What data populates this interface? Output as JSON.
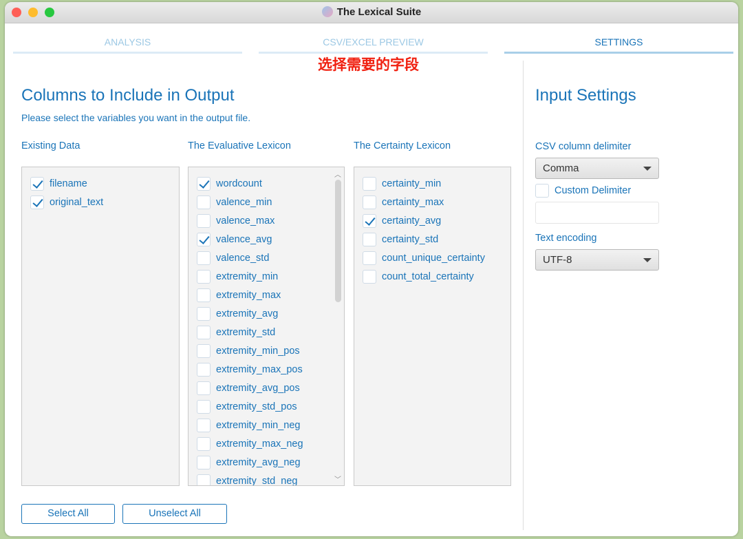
{
  "window": {
    "title": "The Lexical Suite"
  },
  "tabs": [
    {
      "label": "ANALYSIS"
    },
    {
      "label": "CSV/EXCEL PREVIEW"
    },
    {
      "label": "SETTINGS",
      "active": true
    }
  ],
  "annotation": "选择需要的字段",
  "output": {
    "title": "Columns to Include in Output",
    "subtitle": "Please select the variables you want in the output file.",
    "groups": [
      {
        "label": "Existing Data",
        "items": [
          {
            "label": "filename",
            "checked": true
          },
          {
            "label": "original_text",
            "checked": true
          }
        ]
      },
      {
        "label": "The Evaluative Lexicon",
        "items": [
          {
            "label": "wordcount",
            "checked": true
          },
          {
            "label": "valence_min",
            "checked": false
          },
          {
            "label": "valence_max",
            "checked": false
          },
          {
            "label": "valence_avg",
            "checked": true
          },
          {
            "label": "valence_std",
            "checked": false
          },
          {
            "label": "extremity_min",
            "checked": false
          },
          {
            "label": "extremity_max",
            "checked": false
          },
          {
            "label": "extremity_avg",
            "checked": false
          },
          {
            "label": "extremity_std",
            "checked": false
          },
          {
            "label": "extremity_min_pos",
            "checked": false
          },
          {
            "label": "extremity_max_pos",
            "checked": false
          },
          {
            "label": "extremity_avg_pos",
            "checked": false
          },
          {
            "label": "extremity_std_pos",
            "checked": false
          },
          {
            "label": "extremity_min_neg",
            "checked": false
          },
          {
            "label": "extremity_max_neg",
            "checked": false
          },
          {
            "label": "extremity_avg_neg",
            "checked": false
          },
          {
            "label": "extremity_std_neg",
            "checked": false
          }
        ]
      },
      {
        "label": "The Certainty Lexicon",
        "items": [
          {
            "label": "certainty_min",
            "checked": false
          },
          {
            "label": "certainty_max",
            "checked": false
          },
          {
            "label": "certainty_avg",
            "checked": true
          },
          {
            "label": "certainty_std",
            "checked": false
          },
          {
            "label": "count_unique_certainty",
            "checked": false
          },
          {
            "label": "count_total_certainty",
            "checked": false
          }
        ]
      }
    ],
    "select_all": "Select All",
    "unselect_all": "Unselect All"
  },
  "input_settings": {
    "title": "Input Settings",
    "delimiter_label": "CSV column delimiter",
    "delimiter_value": "Comma",
    "custom_delimiter_label": "Custom Delimiter",
    "custom_delimiter_checked": false,
    "custom_delimiter_value": "",
    "encoding_label": "Text encoding",
    "encoding_value": "UTF-8"
  },
  "colors": {
    "accent": "#1a74b8",
    "annotation": "#f02010"
  }
}
